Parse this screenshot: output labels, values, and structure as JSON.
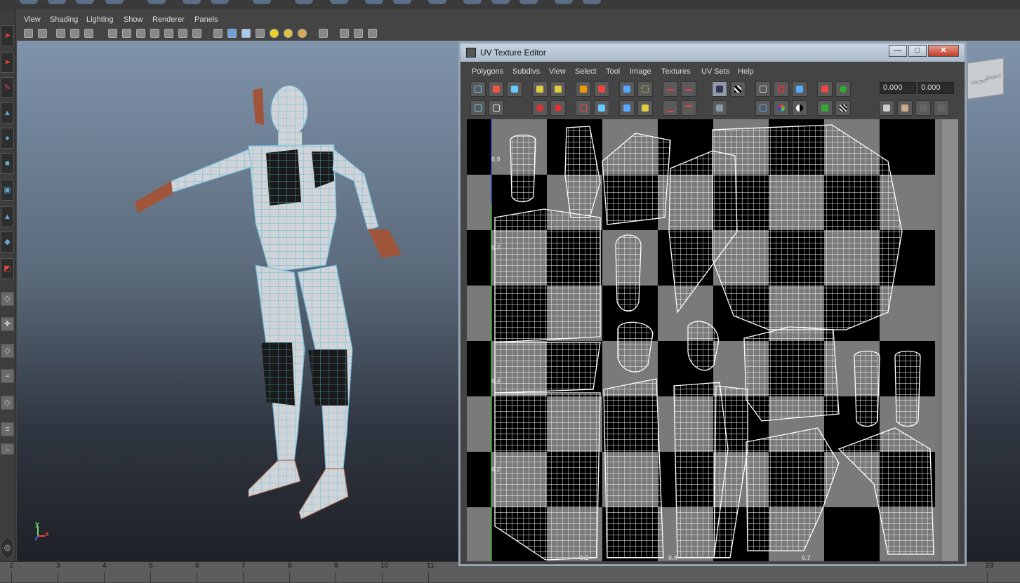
{
  "viewport_menu": [
    "View",
    "Shading",
    "Lighting",
    "Show",
    "Renderer",
    "Panels"
  ],
  "viewcube": {
    "front": "FRONT",
    "right": "RIGHT"
  },
  "axis": {
    "y": "y",
    "x": "x"
  },
  "uv_editor": {
    "title": "UV Texture Editor",
    "menu": [
      "Polygons",
      "Subdivs",
      "View",
      "Select",
      "Tool",
      "Image",
      "Textures",
      "UV Sets",
      "Help"
    ],
    "field_u": "0.000",
    "field_v": "0.000",
    "window_buttons": {
      "minimize": "—",
      "maximize": "□",
      "close": "✕"
    },
    "uv_labels_v": [
      "0.9",
      "0.7",
      "0.4",
      "0.2"
    ],
    "uv_labels_u": [
      "0.2",
      "0.4",
      "0.7"
    ]
  },
  "timeline": {
    "ticks": [
      "2",
      "3",
      "4",
      "5",
      "6",
      "7",
      "8",
      "9",
      "10",
      "11",
      "23"
    ]
  },
  "colors": {
    "viewport_top": "#7f93aa",
    "viewport_bottom": "#1e2127",
    "uv_checker_dark": "#000000",
    "uv_checker_light": "#7a7a7a",
    "close_button": "#c33c2a"
  }
}
